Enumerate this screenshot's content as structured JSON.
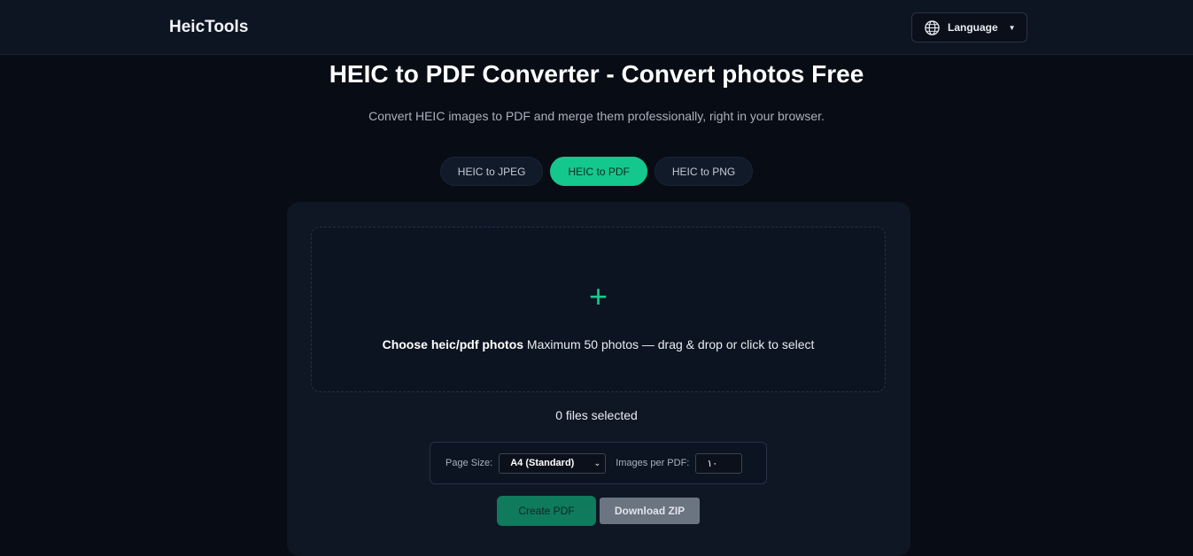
{
  "header": {
    "brand": "HeicTools",
    "language_label": "Language",
    "language_icon": "globe-icon"
  },
  "hero": {
    "title": "HEIC to PDF Converter - Convert photos Free",
    "subtitle": "Convert HEIC images to PDF and merge them professionally, right in your browser."
  },
  "tabs": [
    {
      "label": "HEIC to JPEG",
      "active": false
    },
    {
      "label": "HEIC to PDF",
      "active": true
    },
    {
      "label": "HEIC to PNG",
      "active": false
    }
  ],
  "dropzone": {
    "icon": "plus-icon",
    "strong_text": "Choose heic/pdf photos",
    "text": " Maximum 50 photos — drag & drop or click to select"
  },
  "status": {
    "files_selected": "0  files selected"
  },
  "options": {
    "page_size_label": "Page Size:",
    "page_size_value": "A4 (Standard)",
    "images_per_pdf_label": "Images per PDF:",
    "images_per_pdf_value": "١٠"
  },
  "actions": {
    "create_pdf": "Create PDF",
    "download_zip": "Download ZIP"
  },
  "colors": {
    "accent": "#14c88d",
    "background": "#080c14",
    "card": "#0f1724"
  }
}
